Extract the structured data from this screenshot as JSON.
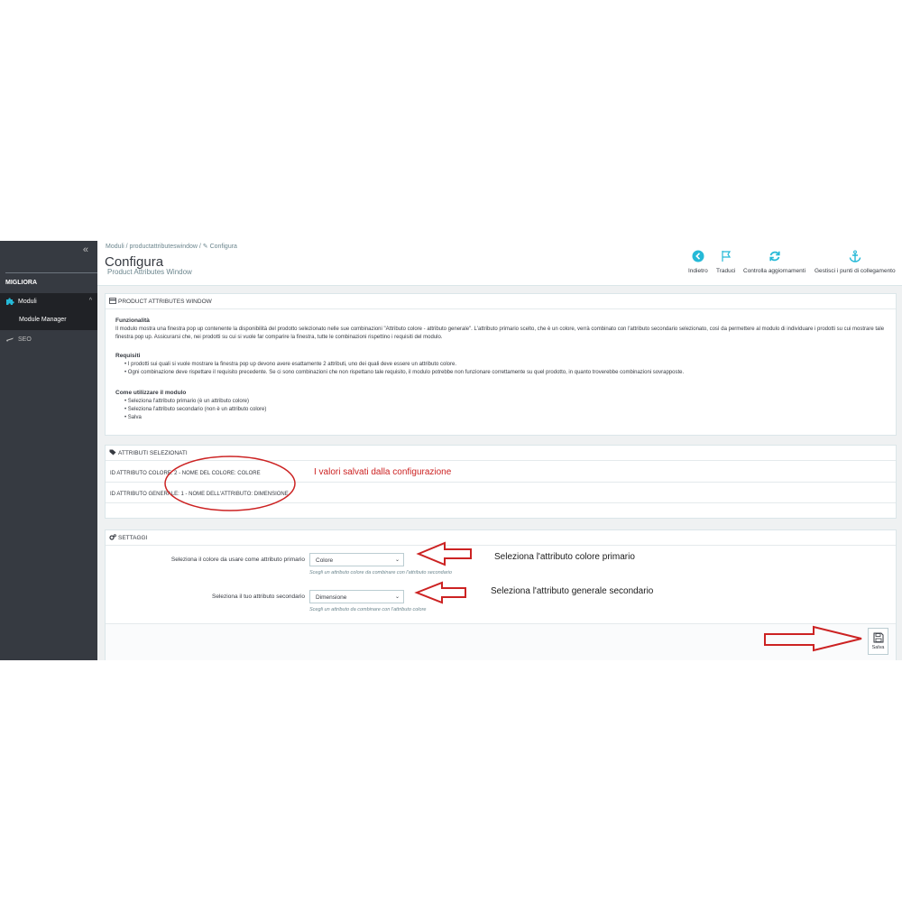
{
  "sidebar": {
    "collapse": "«",
    "section": "MIGLIORA",
    "items": [
      {
        "label": "Moduli",
        "chevron": "^"
      },
      {
        "label": "Module Manager"
      },
      {
        "label": "SEO"
      }
    ]
  },
  "header": {
    "breadcrumb": "Moduli  /  productattributeswindow  /  ✎ Configura",
    "title": "Configura",
    "subtitle": "Product Attributes Window",
    "toolbar": {
      "back": "Indietro",
      "translate": "Traduci",
      "updates": "Controlla aggiornamenti",
      "hooks": "Gestisci i punti di collegamento"
    }
  },
  "panel1": {
    "heading": "PRODUCT ATTRIBUTES WINDOW",
    "functionality_title": "Funzionalità",
    "functionality_text": "Il modulo mostra una finestra pop up contenente la disponibilità del prodotto selezionato nelle sue combinazioni \"Attributo colore - attributo generale\". L'attributo primario scelto, che è un colore, verrà combinato con l'attributo secondario selezionato, così da permettere al modulo di individuare i prodotti su cui mostrare tale finestra pop up. Assicurarsi che, nei prodotti su cui si vuole far comparire la finestra, tutte le combinazioni rispettino i requisiti del modulo.",
    "requirements_title": "Requisiti",
    "requirements": [
      "I prodotti sui quali si vuole mostrare la finestra pop up devono avere esattamente 2 attributi, uno dei quali deve essere un attributo colore.",
      "Ogni combinazione deve rispettare il requisito precedente. Se ci sono combinazioni che non rispettano tale requisito, il modulo potrebbe non funzionare correttamente su quel prodotto, in quanto troverebbe combinazioni sovrapposte."
    ],
    "howto_title": "Come utilizzare il modulo",
    "howto": [
      "Seleziona l'attributo primario (è un attributo colore)",
      "Seleziona l'attributo secondario (non è un attributo colore)",
      "Salva"
    ]
  },
  "panel2": {
    "heading": "ATTRIBUTI SELEZIONATI",
    "row1": "ID ATTRIBUTO COLORE: 2 - NOME DEL COLORE: COLORE",
    "row2": "ID ATTRIBUTO GENERALE: 1 - NOME DELL'ATTRIBUTO: DIMENSIONE"
  },
  "panel3": {
    "heading": "SETTAGGI",
    "primary_label": "Seleziona il colore da usare come attributo primario",
    "primary_value": "Colore",
    "primary_help": "Scegli un attributo colore da combinare con l'attributo secondario",
    "secondary_label": "Seleziona il tuo attributo secondario",
    "secondary_value": "Dimensione",
    "secondary_help": "Scegli un attributo da combinare con l'attributo colore",
    "save": "Salva",
    "caret": "⌄"
  },
  "annotations": {
    "saved": "I valori salvati dalla configurazione",
    "primary": "Seleziona l'attributo colore primario",
    "secondary": "Seleziona l'attributo generale secondario"
  },
  "colors": {
    "sidebar": "#363a41",
    "accent": "#25b9d7",
    "annotation_red": "#cc2222"
  }
}
